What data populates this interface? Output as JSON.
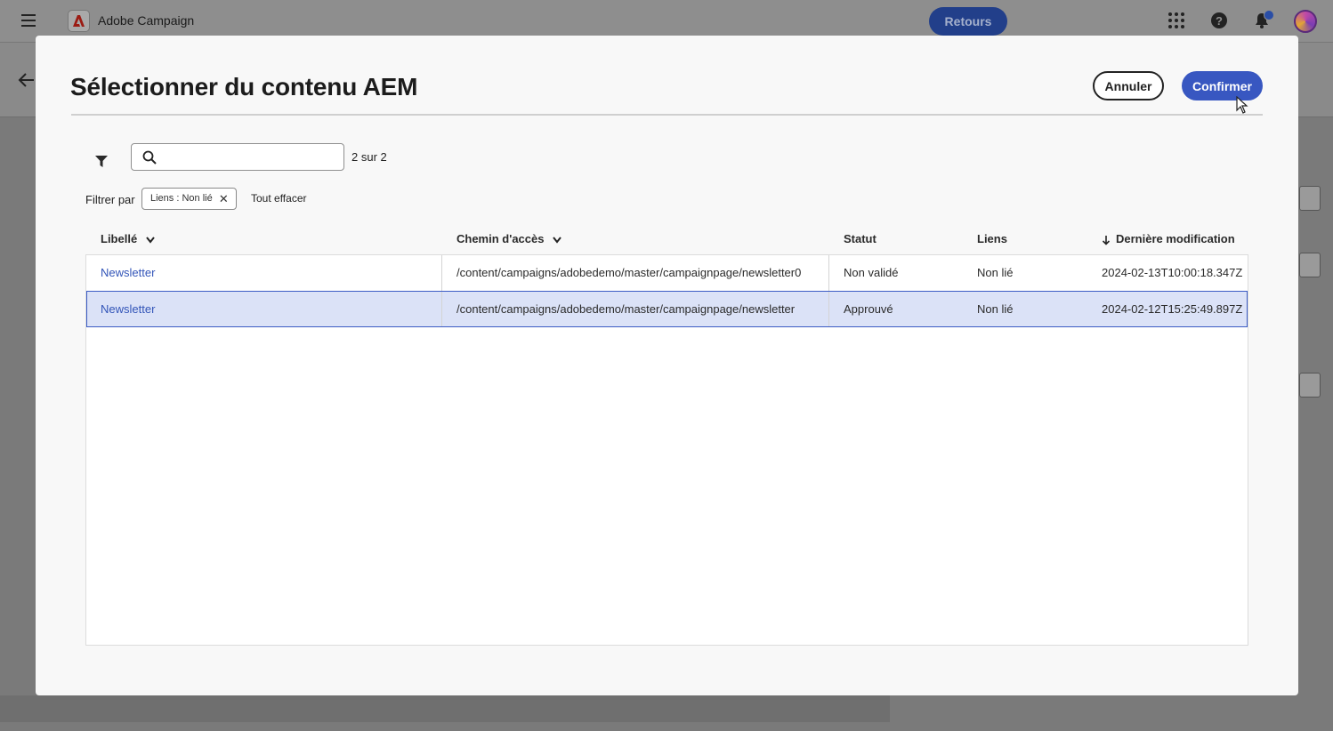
{
  "app": {
    "title": "Adobe Campaign",
    "feedback_label": "Retours"
  },
  "modal": {
    "title": "Sélectionner du contenu AEM",
    "cancel_label": "Annuler",
    "confirm_label": "Confirmer",
    "search": {
      "value": "",
      "placeholder": ""
    },
    "result_count": "2 sur 2",
    "filter_by_label": "Filtrer par",
    "active_filter": "Liens : Non lié",
    "clear_all_label": "Tout effacer"
  },
  "table": {
    "columns": {
      "label": "Libellé",
      "path": "Chemin d'accès",
      "status": "Statut",
      "links": "Liens",
      "modified": "Dernière modification"
    },
    "rows": [
      {
        "label": "Newsletter",
        "path": "/content/campaigns/adobedemo/master/campaignpage/newsletter0",
        "status": "Non validé",
        "links": "Non lié",
        "modified": "2024-02-13T10:00:18.347Z",
        "selected": false
      },
      {
        "label": "Newsletter",
        "path": "/content/campaigns/adobedemo/master/campaignpage/newsletter",
        "status": "Approuvé",
        "links": "Non lié",
        "modified": "2024-02-12T15:25:49.897Z",
        "selected": true
      }
    ]
  },
  "colors": {
    "accent": "#3857c1",
    "link": "#3355b8",
    "selected_row": "#dbe2f7"
  },
  "icons": [
    "menu-icon",
    "adobe-logo-icon",
    "apps-grid-icon",
    "help-icon",
    "bell-icon",
    "back-arrow-icon",
    "filter-icon",
    "search-icon",
    "chevron-down-icon",
    "sort-arrow-down-icon",
    "close-icon"
  ]
}
